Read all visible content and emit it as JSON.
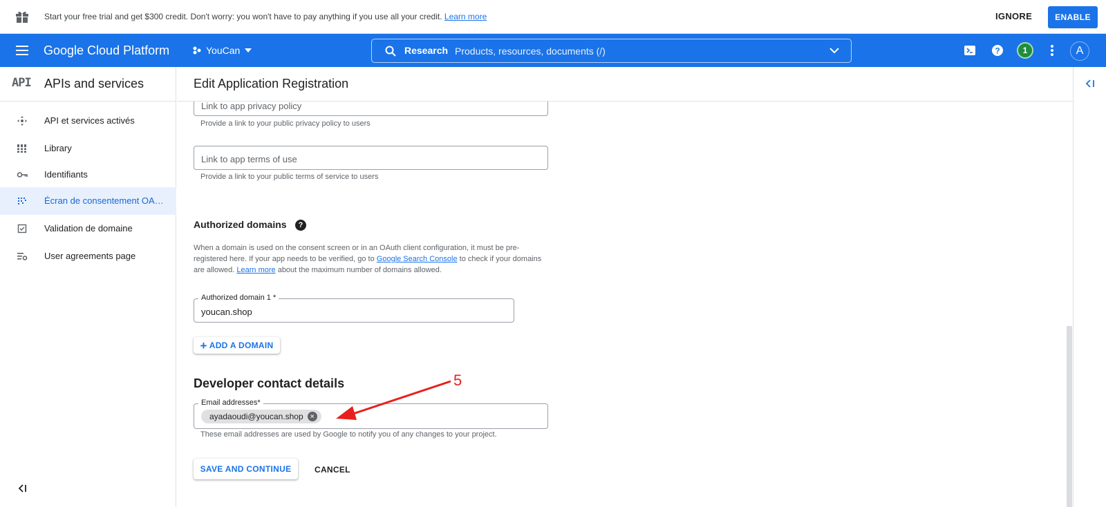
{
  "banner": {
    "message": "Start your free trial and get $300 credit. Don't worry: you won't have to pay anything if you use all your credit.",
    "learn_more": "Learn more",
    "ignore": "IGNORE",
    "enable": "ENABLE",
    "icon": "gift-icon"
  },
  "appbar": {
    "brand": "Google Cloud Platform",
    "project": "YouCan",
    "search_label": "Research",
    "search_placeholder": "Products, resources, documents (/)",
    "notification_count": "1",
    "avatar_letter": "A",
    "color": "#1a73e8"
  },
  "sidebar": {
    "logo": "API",
    "title": "APIs and services",
    "items": [
      {
        "label": "API et services activés",
        "icon": "enabled-apis-icon",
        "active": false
      },
      {
        "label": "Library",
        "icon": "library-icon",
        "active": false
      },
      {
        "label": "Identifiants",
        "icon": "key-icon",
        "active": false
      },
      {
        "label": "Écran de consentement OAuth",
        "icon": "consent-screen-icon",
        "active": true
      },
      {
        "label": "Validation de domaine",
        "icon": "checkbox-icon",
        "active": false
      },
      {
        "label": "User agreements page",
        "icon": "settings-list-icon",
        "active": false
      }
    ]
  },
  "page": {
    "title": "Edit Application Registration"
  },
  "form": {
    "privacy_policy_placeholder": "Link to app privacy policy",
    "privacy_policy_hint": "Provide a link to your public privacy policy to users",
    "terms_placeholder": "Link to app terms of use",
    "terms_hint": "Provide a link to your public terms of service to users",
    "authorized_domains_title": "Authorized domains",
    "authorized_domains_desc_1": "When a domain is used on the consent screen or in an OAuth client configuration, it must be pre-registered here. If your app needs to be verified, go to ",
    "search_console_link": "Google Search Console",
    "authorized_domains_desc_2": " to check if your domains are allowed. ",
    "learn_more": "Learn more",
    "authorized_domains_desc_3": " about the maximum number of domains allowed.",
    "domain_label": "Authorized domain 1 *",
    "domain_value": "youcan.shop",
    "add_domain": "ADD A DOMAIN",
    "developer_title": "Developer contact details",
    "email_label": "Email addresses*",
    "email_chip": "ayadaoudi@youcan.shop",
    "email_hint": "These email addresses are used by Google to notify you of any changes to your project.",
    "save": "SAVE AND CONTINUE",
    "cancel": "CANCEL"
  },
  "annotation": {
    "step_number": "5",
    "color": "#e8201d"
  }
}
